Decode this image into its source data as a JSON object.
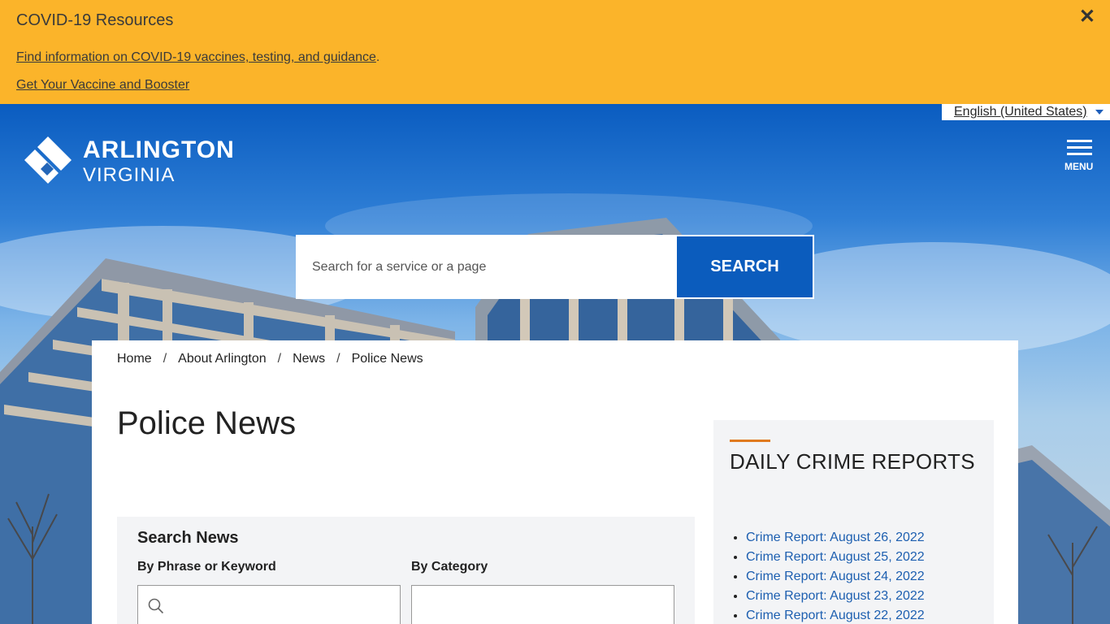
{
  "alert": {
    "title": "COVID-19 Resources",
    "link1": "Find information on COVID-19 vaccines, testing, and guidance",
    "link1_suffix": ".",
    "link2": "Get Your Vaccine and Booster",
    "close": "✕"
  },
  "header": {
    "language": "English (United States)",
    "logo_name": "ARLINGTON",
    "logo_sub": "VIRGINIA",
    "menu_label": "MENU"
  },
  "search": {
    "placeholder": "Search for a service or a page",
    "button_label": "SEARCH"
  },
  "breadcrumb": {
    "items": [
      "Home",
      "About Arlington",
      "News",
      "Police News"
    ],
    "separator": "/"
  },
  "page": {
    "title": "Police News"
  },
  "search_news": {
    "title": "Search News",
    "phrase_label": "By Phrase or Keyword",
    "category_label": "By Category"
  },
  "sidebar": {
    "title": "DAILY CRIME REPORTS",
    "items": [
      "Crime Report: August 26, 2022",
      "Crime Report: August 25, 2022",
      "Crime Report: August 24, 2022",
      "Crime Report: August 23, 2022",
      "Crime Report: August 22, 2022"
    ]
  },
  "colors": {
    "alert_bg": "#fbb42a",
    "brand_blue": "#0b5cbd",
    "accent_orange": "#e07a1f",
    "link_blue": "#1d5fb0"
  }
}
